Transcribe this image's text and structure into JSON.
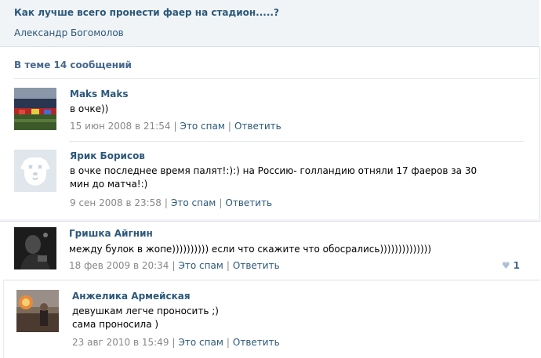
{
  "topic": {
    "title": "Как лучше всего пронести фаер на стадион.....?",
    "author": "Александр Богомолов"
  },
  "thread": {
    "count_label": "В теме 14 сообщений"
  },
  "posts": [
    {
      "author": "Maks Maks",
      "text": "в очке))",
      "date": "15 июн 2008 в 21:54",
      "spam_label": "Это спам",
      "reply_label": "Ответить",
      "avatar_icon": "stadium-photo"
    },
    {
      "author": "Ярик Борисов",
      "text": "в очке последнее время палят!:):) на Россию- голландию отняли 17 фаеров за 30 мин до матча!:)",
      "date": "9 сен 2008 в 23:58",
      "spam_label": "Это спам",
      "reply_label": "Ответить",
      "avatar_icon": "deleted-user-dog-icon"
    },
    {
      "author": "Гришка Айгнин",
      "text": "между булок в жопе)))))))))) если что скажите что обосрались))))))))))))))",
      "date": "18 фев 2009 в 20:34",
      "spam_label": "Это спам",
      "reply_label": "Ответить",
      "likes": "1",
      "avatar_icon": "dark-portrait-photo"
    },
    {
      "author": "Анжелика Армейская",
      "text_lines": [
        "девушкам легче проносить ;)",
        "сама проносила )"
      ],
      "date": "23 авг 2010 в 15:49",
      "spam_label": "Это спам",
      "reply_label": "Ответить",
      "avatar_icon": "flare-photo"
    }
  ],
  "colors": {
    "link": "#2B587A",
    "meta": "#888888",
    "header_bg": "#f1f4f7"
  }
}
